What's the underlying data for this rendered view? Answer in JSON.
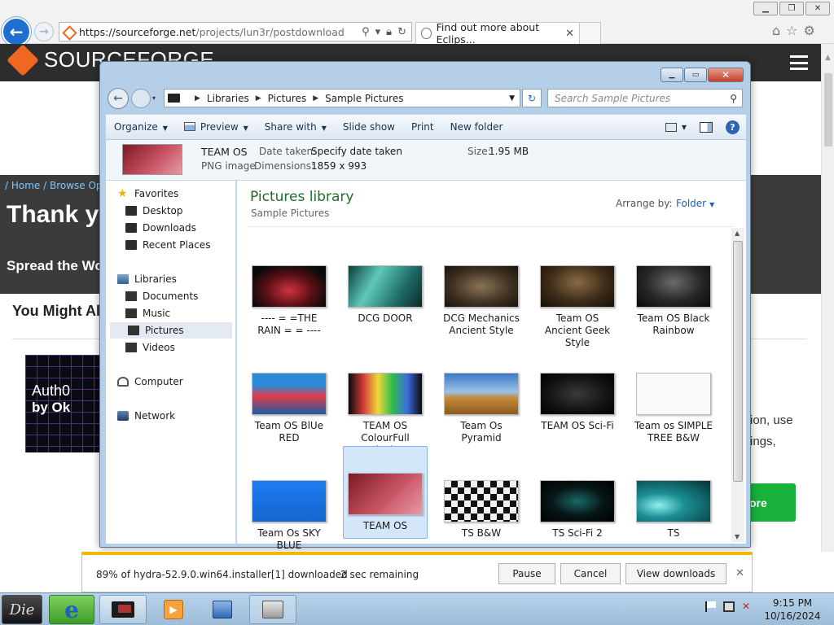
{
  "browser": {
    "url_host": "https://sourceforge.net",
    "url_path": "/projects/lun3r/postdownload",
    "tab_title": "Find out more about Eclips...",
    "icons": [
      "back-arrow-icon",
      "forward-arrow-icon",
      "search-icon",
      "lock-icon",
      "refresh-icon",
      "home-icon",
      "favorites-star-icon",
      "settings-gear-icon"
    ]
  },
  "site": {
    "brand": "SOURCEFORGE",
    "breadcrumb": "/ Home / Browse Open",
    "heading": "Thank yo",
    "spread": "Spread the Wo",
    "might_also": "You Might Als",
    "ad_text_1": "Auth0",
    "ad_text_2": "by Ok",
    "side_text_1": "ion, use",
    "side_text_2": "ings,",
    "more_button": "ore",
    "colors": {
      "header": "#2d2d2d",
      "accent": "#f16622",
      "band": "#3b3b3b",
      "cta": "#18b23b"
    }
  },
  "explorer": {
    "breadcrumb": [
      "Libraries",
      "Pictures",
      "Sample Pictures"
    ],
    "search_placeholder": "Search Sample Pictures",
    "toolbar": {
      "organize": "Organize",
      "preview": "Preview",
      "share_with": "Share with",
      "slide_show": "Slide show",
      "print": "Print",
      "new_folder": "New folder"
    },
    "details": {
      "name": "TEAM OS",
      "type": "PNG image",
      "date_label": "Date taken:",
      "date_value": "Specify date taken",
      "dimensions_label": "Dimensions:",
      "dimensions_value": "1859 x 993",
      "size_label": "Size:",
      "size_value": "1.95 MB"
    },
    "nav": {
      "favorites": "Favorites",
      "desktop": "Desktop",
      "downloads": "Downloads",
      "recent_places": "Recent Places",
      "libraries": "Libraries",
      "documents": "Documents",
      "music": "Music",
      "pictures": "Pictures",
      "videos": "Videos",
      "computer": "Computer",
      "network": "Network"
    },
    "library_title": "Pictures library",
    "library_subtitle": "Sample Pictures",
    "arrange_label": "Arrange by:",
    "arrange_value": "Folder",
    "thumbnails": [
      {
        "label": "---- = =THE RAIN = = ----"
      },
      {
        "label": "DCG DOOR"
      },
      {
        "label": "DCG Mechanics Ancient Style"
      },
      {
        "label": "Team OS Ancient Geek Style"
      },
      {
        "label": "Team OS Black Rainbow"
      },
      {
        "label": "Team OS BlUe RED"
      },
      {
        "label": "TEAM OS ColourFull Blocks"
      },
      {
        "label": "Team Os Pyramid"
      },
      {
        "label": "TEAM OS Sci-Fi"
      },
      {
        "label": "Team os SIMPLE TREE B&W"
      },
      {
        "label": "Team Os SKY BLUE"
      },
      {
        "label": "TEAM OS"
      },
      {
        "label": "TS B&W"
      },
      {
        "label": "TS Sci-Fi 2"
      },
      {
        "label": "TS"
      }
    ]
  },
  "download": {
    "message": "89% of hydra-52.9.0.win64.installer[1] downloaded",
    "progress_percent": 89,
    "remaining": "2 sec remaining",
    "pause": "Pause",
    "cancel": "Cancel",
    "view_downloads": "View downloads"
  },
  "taskbar": {
    "start_label": "Die",
    "time": "9:15 PM",
    "date": "10/16/2024"
  }
}
